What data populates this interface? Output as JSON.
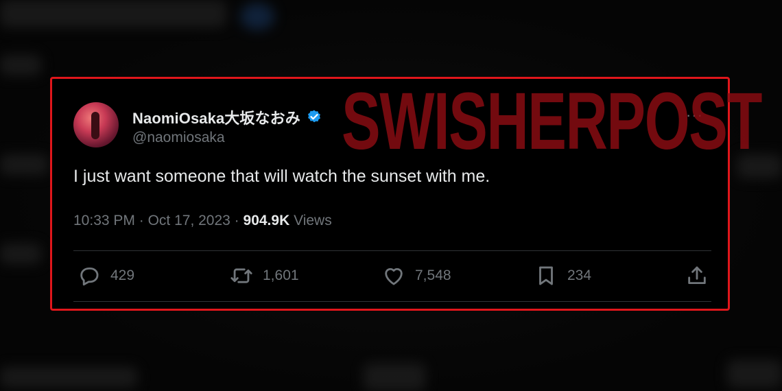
{
  "tweet": {
    "display_name": "NaomiOsaka大坂なおみ",
    "handle": "@naomiosaka",
    "verified": true,
    "more_label": "···",
    "text": "I just want someone that will watch the sunset with me.",
    "time": "10:33 PM",
    "separator": "·",
    "date": "Oct 17, 2023",
    "views_count": "904.9K",
    "views_label": "Views",
    "actions": {
      "reply": {
        "icon": "reply-icon",
        "count": "429"
      },
      "retweet": {
        "icon": "retweet-icon",
        "count": "1,601"
      },
      "like": {
        "icon": "heart-icon",
        "count": "7,548"
      },
      "bookmark": {
        "icon": "bookmark-icon",
        "count": "234"
      },
      "share": {
        "icon": "share-icon"
      }
    }
  },
  "highlight_color": "#e0161b",
  "verified_color": "#1d9bf0",
  "watermark": "SWISHERPOST"
}
